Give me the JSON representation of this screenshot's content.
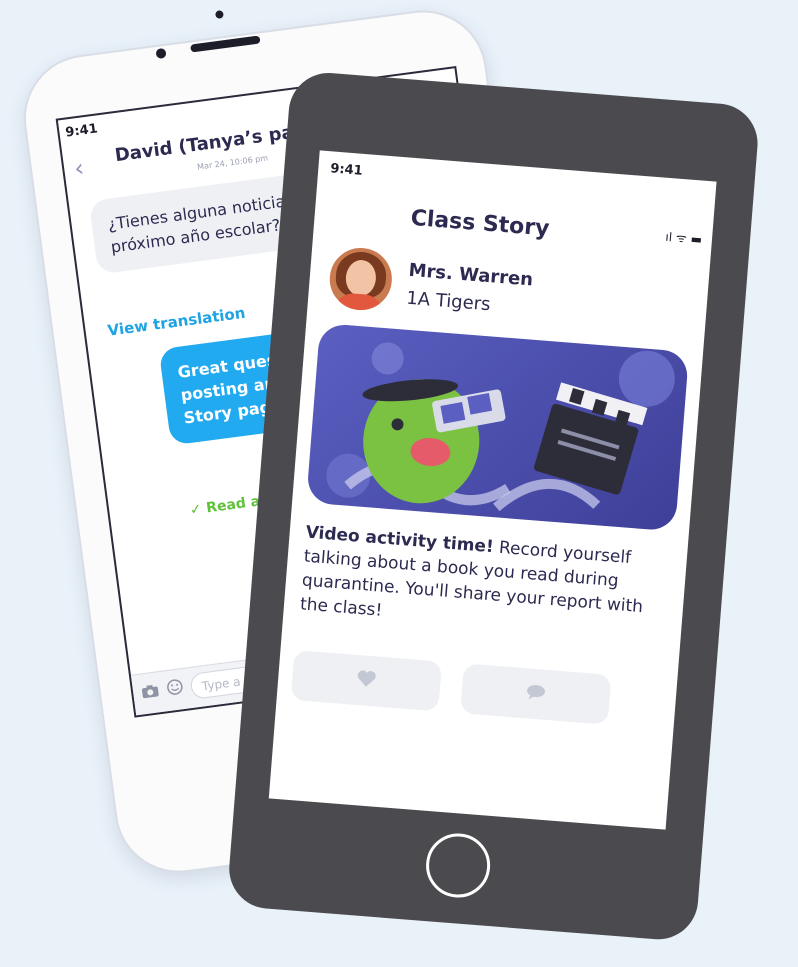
{
  "chat_phone": {
    "time": "9:41",
    "status_icons": "ıl ᯤ ▬",
    "back_icon": "‹",
    "contact_name": "David (Tanya’s parent)",
    "date": "Mar 24, 10:06 pm",
    "incoming_message": "¿Tienes alguna noticia sobre el próximo año escolar?",
    "view_translation": "View translation",
    "outgoing_message": "Great question! As I g info, I'll be posting an updates on our Clas Story page 😊",
    "read_receipt": "✓ Read at 10:12 PM",
    "input_placeholder": "Type a new messag",
    "camera_icon": "camera-icon",
    "emoji_icon": "emoji-icon"
  },
  "story_phone": {
    "time": "9:41",
    "status_icons": "ıl ᯤ ▬",
    "title": "Class Story",
    "teacher_name": "Mrs. Warren",
    "class_name": "1A Tigers",
    "post_heading": "Video activity time!",
    "post_body": " Record yourself talking about a book you read during quarantine. You'll share your report with the class!",
    "like_icon": "heart-icon",
    "comment_icon": "comment-icon"
  },
  "colors": {
    "background": "#e9f1f9",
    "accent_blue": "#21aaf0",
    "read_green": "#5fc23a",
    "dark_phone": "#4b4b4f",
    "title_navy": "#2c2a50"
  }
}
